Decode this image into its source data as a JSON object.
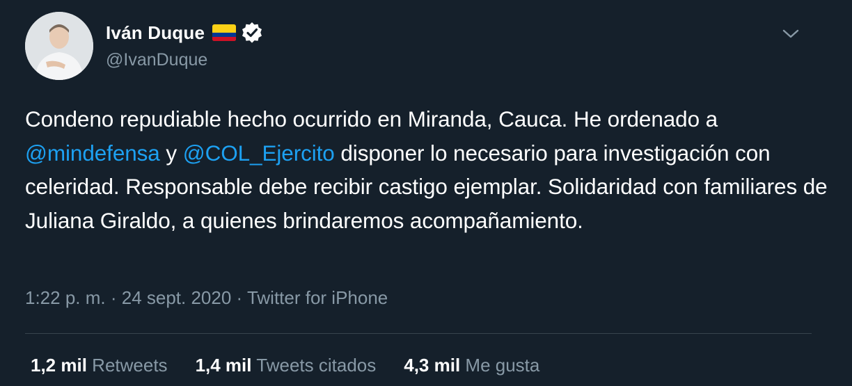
{
  "author": {
    "display_name": "Iván Duque",
    "handle": "@IvanDuque",
    "flag_icon": "colombia-flag-icon",
    "verified_icon": "verified-badge-icon"
  },
  "tweet": {
    "text_1": "Condeno repudiable hecho ocurrido en Miranda, Cauca. He ordenado a ",
    "mention_1": "@mindefensa",
    "text_2": " y ",
    "mention_2": "@COL_Ejercito",
    "text_3": " disponer lo necesario para investigación con celeridad. Responsable debe recibir castigo ejemplar. Solidaridad con familiares de Juliana Giraldo, a quienes brindaremos acompañamiento."
  },
  "meta": {
    "time": "1:22 p. m.",
    "separator_1": " · ",
    "date": "24 sept. 2020",
    "separator_2": " · ",
    "source": "Twitter for iPhone"
  },
  "stats": {
    "retweets_count": "1,2 mil",
    "retweets_label": "Retweets",
    "quotes_count": "1,4 mil",
    "quotes_label": "Tweets citados",
    "likes_count": "4,3 mil",
    "likes_label": "Me gusta"
  },
  "colors": {
    "background": "#15202b",
    "link": "#1da1f2",
    "secondary_text": "#8899a6",
    "divider": "#38444d"
  }
}
